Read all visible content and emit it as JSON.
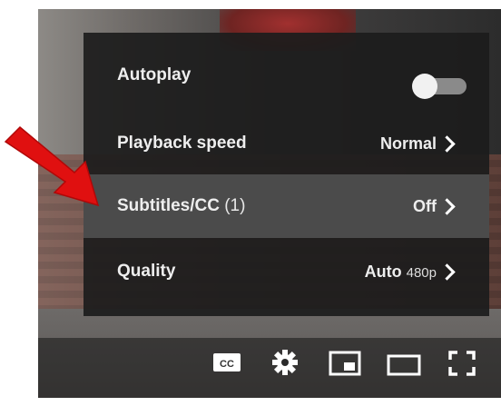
{
  "settings_menu": {
    "items": [
      {
        "label": "Autoplay",
        "type": "toggle"
      },
      {
        "label": "Playback speed",
        "value": "Normal"
      },
      {
        "label": "Subtitles/CC",
        "count": "(1)",
        "value": "Off"
      },
      {
        "label": "Quality",
        "value": "Auto",
        "resolution": "480p"
      }
    ],
    "autoplay_enabled": false,
    "highlighted_item": "Subtitles/CC"
  },
  "annotation": {
    "icon": "red-arrow-icon",
    "color": "#e01010"
  },
  "controls": {
    "icons": [
      "subtitles-cc-icon",
      "settings-gear-icon",
      "miniplayer-icon",
      "theater-mode-icon",
      "fullscreen-icon"
    ],
    "cc_label": "CC"
  },
  "colors": {
    "menu_bg": "#1c1c1c",
    "highlight_bg": "#505050",
    "text": "#eeeeee"
  }
}
